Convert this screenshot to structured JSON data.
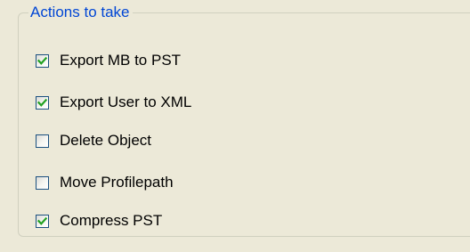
{
  "group": {
    "title": "Actions to take"
  },
  "actions": [
    {
      "label": "Export MB to PST",
      "checked": true
    },
    {
      "label": "Export User to XML",
      "checked": true
    },
    {
      "label": "Delete Object",
      "checked": false
    },
    {
      "label": "Move Profilepath",
      "checked": false
    },
    {
      "label": "Compress PST",
      "checked": true
    }
  ],
  "colors": {
    "window_bg": "#ece9d8",
    "group_title": "#0046d5",
    "group_border": "#d0d0bf",
    "checkbox_border": "#1c5180",
    "checkmark": "#21a121"
  },
  "icons": {
    "checkmark": "checkmark-icon"
  }
}
